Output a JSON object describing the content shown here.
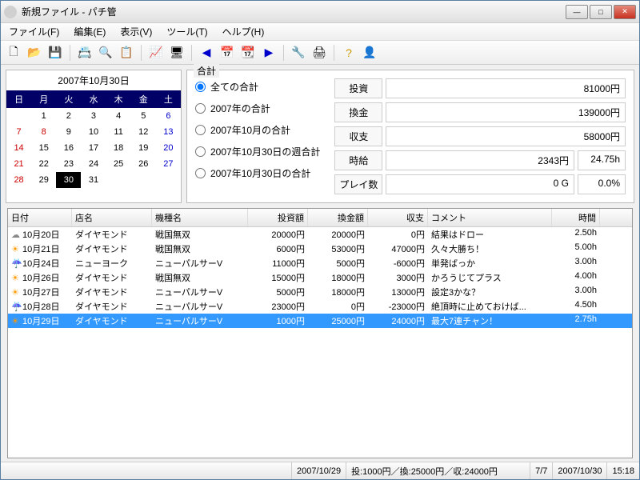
{
  "window": {
    "title": "新規ファイル - パチ管"
  },
  "menu": {
    "file": "ファイル(F)",
    "edit": "編集(E)",
    "view": "表示(V)",
    "tools": "ツール(T)",
    "help": "ヘルプ(H)"
  },
  "calendar": {
    "title": "2007年10月30日",
    "dow": [
      "日",
      "月",
      "火",
      "水",
      "木",
      "金",
      "土"
    ],
    "cells": [
      {
        "t": "",
        "c": ""
      },
      {
        "t": "1",
        "c": ""
      },
      {
        "t": "2",
        "c": ""
      },
      {
        "t": "3",
        "c": ""
      },
      {
        "t": "4",
        "c": ""
      },
      {
        "t": "5",
        "c": ""
      },
      {
        "t": "6",
        "c": "sat"
      },
      {
        "t": "7",
        "c": "sun"
      },
      {
        "t": "8",
        "c": "sun"
      },
      {
        "t": "9",
        "c": ""
      },
      {
        "t": "10",
        "c": ""
      },
      {
        "t": "11",
        "c": ""
      },
      {
        "t": "12",
        "c": ""
      },
      {
        "t": "13",
        "c": "sat"
      },
      {
        "t": "14",
        "c": "sun"
      },
      {
        "t": "15",
        "c": ""
      },
      {
        "t": "16",
        "c": ""
      },
      {
        "t": "17",
        "c": ""
      },
      {
        "t": "18",
        "c": ""
      },
      {
        "t": "19",
        "c": ""
      },
      {
        "t": "20",
        "c": "sat"
      },
      {
        "t": "21",
        "c": "sun"
      },
      {
        "t": "22",
        "c": ""
      },
      {
        "t": "23",
        "c": ""
      },
      {
        "t": "24",
        "c": ""
      },
      {
        "t": "25",
        "c": ""
      },
      {
        "t": "26",
        "c": ""
      },
      {
        "t": "27",
        "c": "sat"
      },
      {
        "t": "28",
        "c": "sun"
      },
      {
        "t": "29",
        "c": ""
      },
      {
        "t": "30",
        "c": "sel"
      },
      {
        "t": "31",
        "c": ""
      },
      {
        "t": "",
        "c": ""
      },
      {
        "t": "",
        "c": ""
      },
      {
        "t": "",
        "c": ""
      }
    ]
  },
  "summary": {
    "legend": "合計",
    "radios": {
      "all": "全ての合計",
      "year": "2007年の合計",
      "month": "2007年10月の合計",
      "week": "2007年10月30日の週合計",
      "day": "2007年10月30日の合計"
    },
    "stats": {
      "invest_l": "投資",
      "invest_v": "81000円",
      "exchange_l": "換金",
      "exchange_v": "139000円",
      "balance_l": "収支",
      "balance_v": "58000円",
      "wage_l": "時給",
      "wage_v": "2343円",
      "hours_v": "24.75h",
      "plays_l": "プレイ数",
      "plays_v": "0 G",
      "pct_v": "0.0%"
    }
  },
  "columns": {
    "date": "日付",
    "shop": "店名",
    "machine": "機種名",
    "invest": "投資額",
    "exchange": "換金額",
    "balance": "収支",
    "comment": "コメント",
    "time": "時間"
  },
  "rows": [
    {
      "w": "cloud",
      "date": "10月20日",
      "shop": "ダイヤモンド",
      "machine": "戦国無双",
      "invest": "20000円",
      "exchange": "20000円",
      "balance": "0円",
      "comment": "結果はドロー",
      "time": "2.50h",
      "sel": false
    },
    {
      "w": "sun",
      "date": "10月21日",
      "shop": "ダイヤモンド",
      "machine": "戦国無双",
      "invest": "6000円",
      "exchange": "53000円",
      "balance": "47000円",
      "comment": "久々大勝ち！",
      "time": "5.00h",
      "sel": false
    },
    {
      "w": "rain",
      "date": "10月24日",
      "shop": "ニューヨーク",
      "machine": "ニューパルサーV",
      "invest": "11000円",
      "exchange": "5000円",
      "balance": "-6000円",
      "comment": "単発ばっか",
      "time": "3.00h",
      "sel": false
    },
    {
      "w": "sun",
      "date": "10月26日",
      "shop": "ダイヤモンド",
      "machine": "戦国無双",
      "invest": "15000円",
      "exchange": "18000円",
      "balance": "3000円",
      "comment": "かろうじてプラス",
      "time": "4.00h",
      "sel": false
    },
    {
      "w": "sun",
      "date": "10月27日",
      "shop": "ダイヤモンド",
      "machine": "ニューパルサーV",
      "invest": "5000円",
      "exchange": "18000円",
      "balance": "13000円",
      "comment": "設定3かな？",
      "time": "3.00h",
      "sel": false
    },
    {
      "w": "rain",
      "date": "10月28日",
      "shop": "ダイヤモンド",
      "machine": "ニューパルサーV",
      "invest": "23000円",
      "exchange": "0円",
      "balance": "-23000円",
      "comment": "絶頂時に止めておけば...",
      "time": "4.50h",
      "sel": false
    },
    {
      "w": "sun",
      "date": "10月29日",
      "shop": "ダイヤモンド",
      "machine": "ニューパルサーV",
      "invest": "1000円",
      "exchange": "25000円",
      "balance": "24000円",
      "comment": "最大7連チャン！",
      "time": "2.75h",
      "sel": true
    }
  ],
  "status": {
    "date": "2007/10/29",
    "summary": "投:1000円／換:25000円／収:24000円",
    "count": "7/7",
    "today": "2007/10/30",
    "time": "15:18"
  }
}
